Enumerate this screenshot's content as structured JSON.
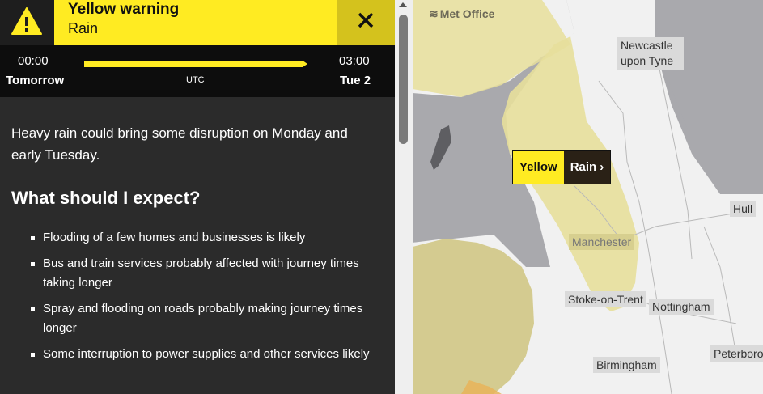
{
  "warning": {
    "title": "Yellow warning",
    "type": "Rain",
    "close_icon": "close-icon",
    "alert_icon": "warning-triangle-icon",
    "color": "#ffeb22"
  },
  "timeline": {
    "start_time": "00:00",
    "start_day": "Tomorrow",
    "timezone": "UTC",
    "end_time": "03:00",
    "end_day": "Tue 2"
  },
  "content": {
    "summary": "Heavy rain could bring some disruption on Monday and early Tuesday.",
    "expect_heading": "What should I expect?",
    "impacts": [
      "Flooding of a few homes and businesses is likely",
      "Bus and train services probably affected with journey times taking longer",
      "Spray and flooding on roads probably making journey times longer",
      "Some interruption to power supplies and other services likely"
    ]
  },
  "map": {
    "logo": "Met Office",
    "cities": [
      "Newcastle upon Tyne",
      "Hull",
      "Manchester",
      "Stoke-on-Trent",
      "Nottingham",
      "Birmingham",
      "Peterboro"
    ],
    "warning_label": {
      "level": "Yellow",
      "type": "Rain"
    }
  }
}
